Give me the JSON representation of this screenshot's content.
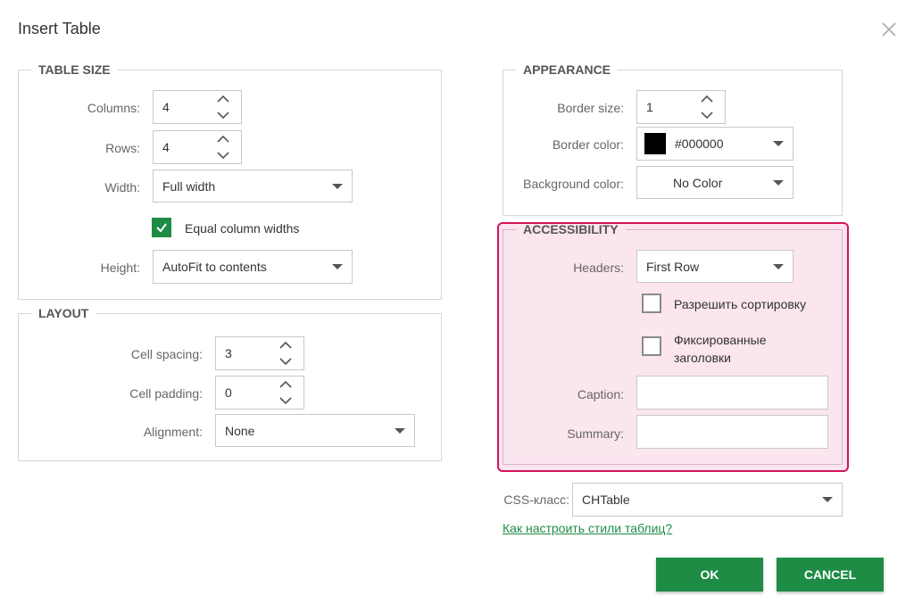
{
  "dialog": {
    "title": "Insert Table"
  },
  "table_size": {
    "legend": "TABLE SIZE",
    "columns_label": "Columns:",
    "columns_value": "4",
    "rows_label": "Rows:",
    "rows_value": "4",
    "width_label": "Width:",
    "width_value": "Full width",
    "equal_widths_label": "Equal column widths",
    "equal_widths_checked": true,
    "height_label": "Height:",
    "height_value": "AutoFit to contents"
  },
  "layout": {
    "legend": "LAYOUT",
    "cell_spacing_label": "Cell spacing:",
    "cell_spacing_value": "3",
    "cell_padding_label": "Cell padding:",
    "cell_padding_value": "0",
    "alignment_label": "Alignment:",
    "alignment_value": "None"
  },
  "appearance": {
    "legend": "APPEARANCE",
    "border_size_label": "Border size:",
    "border_size_value": "1",
    "border_color_label": "Border color:",
    "border_color_value": "#000000",
    "background_color_label": "Background color:",
    "background_color_value": "No Color"
  },
  "accessibility": {
    "legend": "ACCESSIBILITY",
    "headers_label": "Headers:",
    "headers_value": "First Row",
    "sorting_label": "Разрешить сортировку",
    "fixed_headers_line1": "Фиксированные",
    "fixed_headers_line2": "заголовки",
    "caption_label": "Caption:",
    "caption_value": "",
    "summary_label": "Summary:",
    "summary_value": ""
  },
  "css_class": {
    "label": "CSS-класс:",
    "value": "CHTable"
  },
  "help_link": "Как настроить стили таблиц?",
  "buttons": {
    "ok": "OK",
    "cancel": "CANCEL"
  },
  "colors": {
    "accent": "#1e8c45",
    "highlight_border": "#d4145a"
  }
}
